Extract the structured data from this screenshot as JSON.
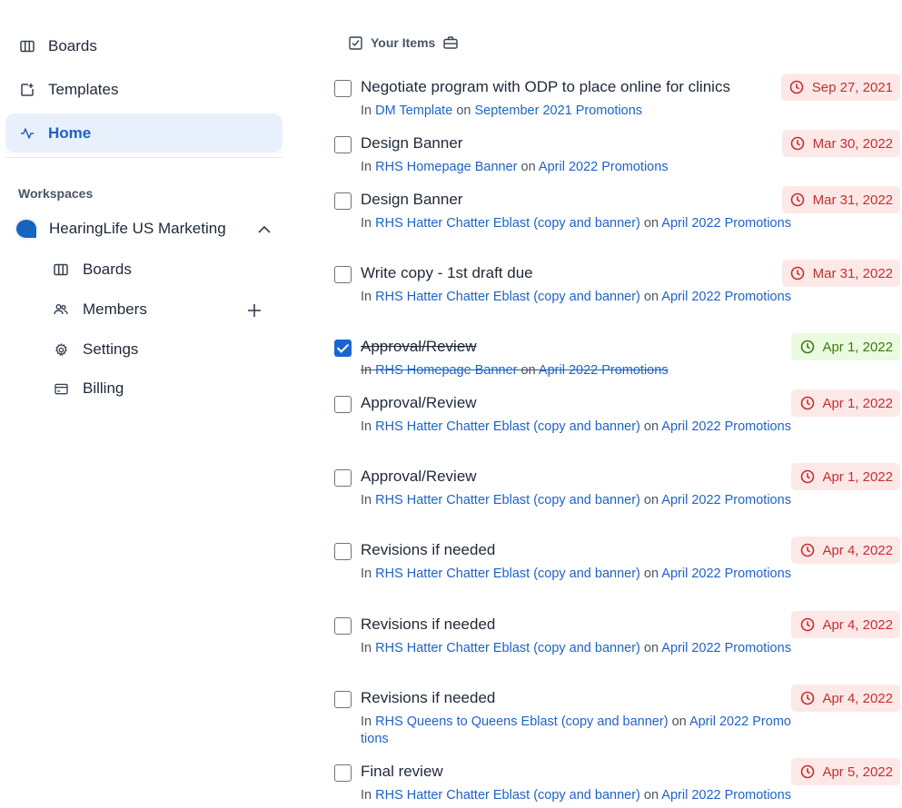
{
  "sidebar": {
    "nav": [
      {
        "label": "Boards",
        "icon": "board-icon"
      },
      {
        "label": "Templates",
        "icon": "template-icon"
      },
      {
        "label": "Home",
        "icon": "activity-icon",
        "active": true
      }
    ],
    "workspaces_heading": "Workspaces",
    "workspace": {
      "name": "HearingLife US Marketing",
      "items": [
        {
          "label": "Boards",
          "icon": "board-icon"
        },
        {
          "label": "Members",
          "icon": "members-icon"
        },
        {
          "label": "Settings",
          "icon": "gear-icon"
        },
        {
          "label": "Billing",
          "icon": "credit-card-icon"
        }
      ]
    }
  },
  "main": {
    "heading": "Your Items",
    "in_word": "In",
    "on_word": "on",
    "items": [
      {
        "title": "Negotiate program with ODP to place online for clinics",
        "card": "DM Template",
        "list": "September 2021 Promotions",
        "due": "Sep 27, 2021",
        "status": "overdue",
        "checked": false
      },
      {
        "title": "Design Banner",
        "card": "RHS Homepage Banner",
        "list": "April 2022 Promotions",
        "due": "Mar 30, 2022",
        "status": "overdue",
        "checked": false
      },
      {
        "title": "Design Banner",
        "card": "RHS Hatter Chatter Eblast (copy and banner)",
        "list": "April 2022 Promotions",
        "due": "Mar 31, 2022",
        "status": "overdue",
        "checked": false
      },
      {
        "title": "Write copy - 1st draft due",
        "card": "RHS Hatter Chatter Eblast (copy and banner)",
        "list": "April 2022 Promotions",
        "due": "Mar 31, 2022",
        "status": "overdue",
        "checked": false
      },
      {
        "title": "Approval/Review",
        "card": "RHS Homepage Banner",
        "list": "April 2022 Promotions",
        "due": "Apr 1, 2022",
        "status": "complete",
        "checked": true
      },
      {
        "title": "Approval/Review",
        "card": "RHS Hatter Chatter Eblast (copy and banner)",
        "list": "April 2022 Promotions",
        "due": "Apr 1, 2022",
        "status": "overdue",
        "checked": false
      },
      {
        "title": "Approval/Review",
        "card": "RHS Hatter Chatter Eblast (copy and banner)",
        "list": "April 2022 Promotions",
        "due": "Apr 1, 2022",
        "status": "overdue",
        "checked": false
      },
      {
        "title": "Revisions if needed",
        "card": "RHS Hatter Chatter Eblast (copy and banner)",
        "list": "April 2022 Promotions",
        "due": "Apr 4, 2022",
        "status": "overdue",
        "checked": false
      },
      {
        "title": "Revisions if needed",
        "card": "RHS Hatter Chatter Eblast (copy and banner)",
        "list": "April 2022 Promotions",
        "due": "Apr 4, 2022",
        "status": "overdue",
        "checked": false
      },
      {
        "title": "Revisions if needed",
        "card": "RHS Queens to Queens Eblast (copy and banner)",
        "list": "April 2022 Promotions",
        "due": "Apr 4, 2022",
        "status": "overdue",
        "checked": false
      },
      {
        "title": "Final review",
        "card": "RHS Hatter Chatter Eblast (copy and banner)",
        "list": "April 2022 Promotions",
        "due": "Apr 5, 2022",
        "status": "overdue",
        "checked": false
      }
    ]
  },
  "colors": {
    "accent": "#1f63c6",
    "active_nav_bg": "#e8f0fc",
    "overdue_bg": "#fde8e8",
    "overdue_text": "#c53030",
    "complete_bg": "#eafbe0",
    "complete_text": "#3d7a15"
  }
}
